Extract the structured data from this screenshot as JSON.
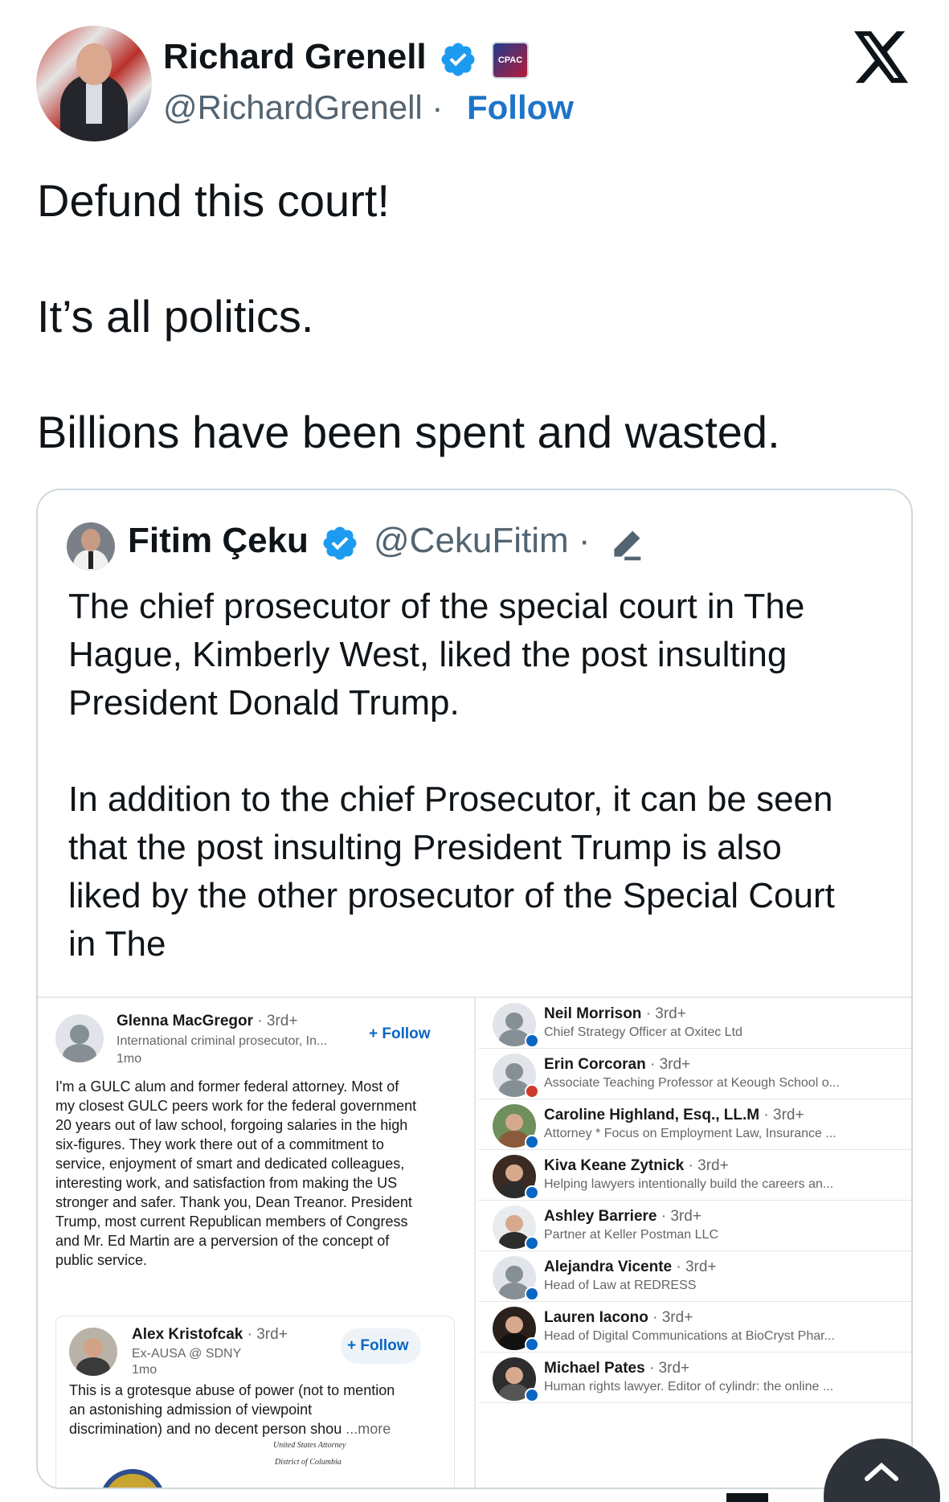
{
  "post": {
    "author_name": "Richard Grenell",
    "handle": "@RichardGrenell ·",
    "follow_label": "Follow",
    "badge_text": "CPAC",
    "brand_logo": "X",
    "text_lines": [
      "Defund this court!",
      "It’s all politics.",
      "Billions have been spent and wasted."
    ]
  },
  "quote": {
    "author_name": "Fitim Çeku",
    "handle": "@CekuFitim ·",
    "text_lines": [
      "The chief prosecutor of the special court in The",
      "Hague, Kimberly West, liked the post insulting",
      "President Donald Trump.",
      "In addition to the chief Prosecutor, it can be seen",
      "that the post insulting President Trump is also",
      "liked by the other prosecutor of the Special Court",
      "in The"
    ]
  },
  "screenshot": {
    "main_comment": {
      "name": "Glenna MacGregor",
      "degree": " · 3rd+",
      "title": "International criminal prosecutor, In...",
      "time": "1mo",
      "follow_label": "+ Follow",
      "body_lines": [
        "I'm a GULC alum and former federal attorney. Most of",
        "my closest GULC peers work for the federal government",
        "20 years out of law school, forgoing salaries in the high",
        "six-figures. They work there out of a commitment to",
        "service, enjoyment of smart and dedicated colleagues,",
        "interesting work, and satisfaction from making the US",
        "stronger and safer. Thank you, Dean Treanor. President",
        "Trump, most current Republican members of Congress",
        "and Mr. Ed Martin are a perversion of the concept of",
        "public service."
      ]
    },
    "reply": {
      "name": "Alex Kristofcak",
      "degree": " · 3rd+",
      "title": "Ex-AUSA @ SDNY",
      "time": "1mo",
      "follow_label": "+ Follow",
      "body_lines": [
        "This is a grotesque abuse of power (not to mention",
        "an astonishing admission of viewpoint",
        "discrimination) and no decent person shou"
      ],
      "more_label": "...more",
      "doc_line1": "United States Attorney",
      "doc_line2": "District of Columbia"
    },
    "likers": [
      {
        "name": "Neil Morrison",
        "degree": " · 3rd+",
        "title": "Chief Strategy Officer at Oxitec Ltd"
      },
      {
        "name": "Erin Corcoran",
        "degree": " · 3rd+",
        "title": "Associate Teaching Professor at Keough School o..."
      },
      {
        "name": "Caroline Highland, Esq., LL.M",
        "degree": " · 3rd+",
        "title": "Attorney * Focus on Employment Law, Insurance ..."
      },
      {
        "name": "Kiva Keane Zytnick",
        "degree": " · 3rd+",
        "title": "Helping lawyers intentionally build the careers an..."
      },
      {
        "name": "Ashley Barriere",
        "degree": " · 3rd+",
        "title": "Partner at Keller Postman LLC"
      },
      {
        "name": "Alejandra Vicente",
        "degree": " · 3rd+",
        "title": "Head of Law at REDRESS"
      },
      {
        "name": "Lauren Iacono",
        "degree": " · 3rd+",
        "title": "Head of Digital Communications at BioCryst Phar..."
      },
      {
        "name": "Michael Pates",
        "degree": " · 3rd+",
        "title": "Human rights lawyer. Editor of cylindr: the online ..."
      }
    ]
  },
  "colors": {
    "verified": "#1d9bf0",
    "follow_link": "#1d74c9",
    "linkedin_blue": "#0a66c2"
  },
  "icons": [
    "verified-badge-icon",
    "x-logo-icon",
    "edit-pencil-icon",
    "scroll-up-arrow-icon"
  ]
}
